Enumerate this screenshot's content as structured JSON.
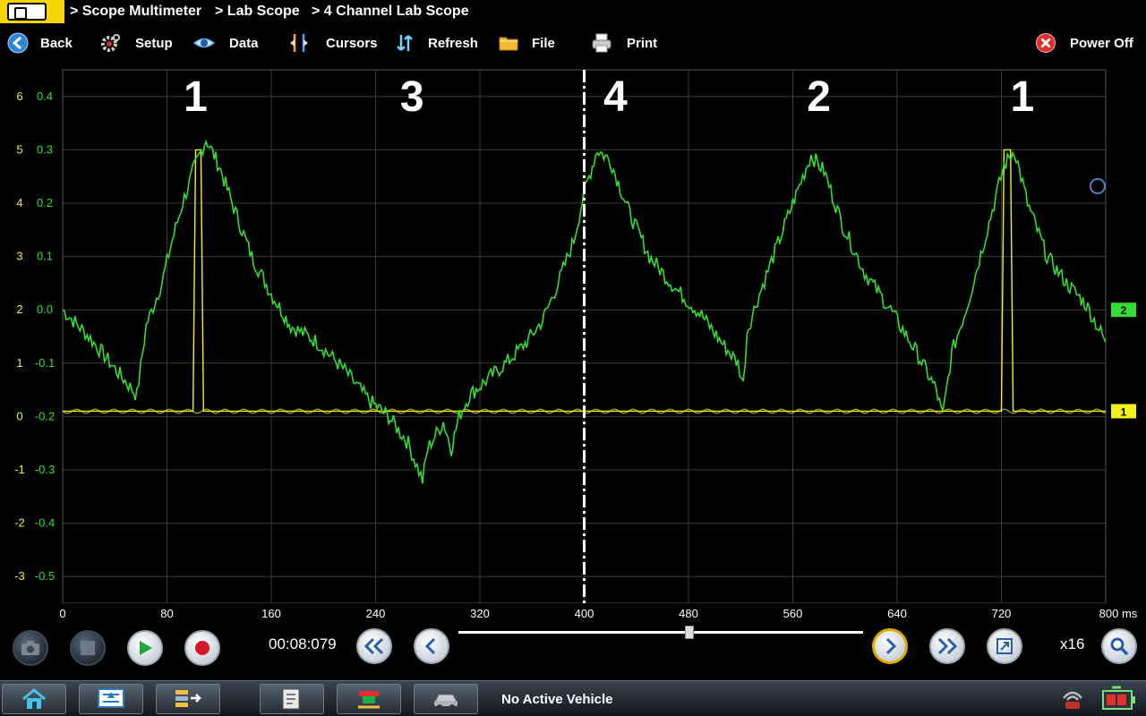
{
  "breadcrumb": {
    "items": [
      "> Scope Multimeter",
      "> Lab Scope",
      "> 4 Channel Lab Scope"
    ]
  },
  "toolbar": {
    "back_label": "Back",
    "setup_label": "Setup",
    "data_label": "Data",
    "cursors_label": "Cursors",
    "refresh_label": "Refresh",
    "file_label": "File",
    "print_label": "Print",
    "power_off_label": "Power Off"
  },
  "colors": {
    "channel1": "#f2f21b",
    "channel2": "#33dd33",
    "grid": "#3a3a3a",
    "accent_yellow": "#f5d400",
    "power_off_red": "#e03030"
  },
  "chart_data": {
    "type": "line",
    "x_unit": "ms",
    "x_ticks": [
      "0",
      "80",
      "160",
      "240",
      "320",
      "400",
      "480",
      "560",
      "640",
      "720",
      "800 ms"
    ],
    "xlim": [
      0,
      800
    ],
    "y_ticks_channel1": [
      "6",
      "5",
      "4",
      "3",
      "2",
      "1",
      "0",
      "-1",
      "-2",
      "-3"
    ],
    "y_ticks_channel2": [
      "0.4",
      "0.3",
      "0.2",
      "0.1",
      "0.0",
      "-0.1",
      "-0.2",
      "-0.3",
      "-0.4",
      "-0.5"
    ],
    "ylim_channel2": [
      -0.55,
      0.45
    ],
    "annotations": [
      {
        "text": "1",
        "x": 102
      },
      {
        "text": "3",
        "x": 268
      },
      {
        "text": "4",
        "x": 424
      },
      {
        "text": "2",
        "x": 580
      },
      {
        "text": "1",
        "x": 736
      }
    ],
    "cursor_x": 400,
    "series": [
      {
        "channel_marker": "1",
        "values": [
          [
            0,
            -0.19
          ],
          [
            100,
            -0.19
          ],
          [
            102,
            0.3
          ],
          [
            106,
            0.3
          ],
          [
            108,
            -0.19
          ],
          [
            720,
            -0.19
          ],
          [
            722,
            0.3
          ],
          [
            727,
            0.3
          ],
          [
            729,
            -0.19
          ],
          [
            800,
            -0.19
          ]
        ]
      },
      {
        "channel_marker": "2",
        "values": [
          [
            0,
            0.0
          ],
          [
            20,
            -0.05
          ],
          [
            40,
            -0.11
          ],
          [
            57,
            -0.16
          ],
          [
            64,
            -0.03
          ],
          [
            76,
            0.05
          ],
          [
            84,
            0.13
          ],
          [
            92,
            0.2
          ],
          [
            100,
            0.26
          ],
          [
            110,
            0.32
          ],
          [
            120,
            0.27
          ],
          [
            130,
            0.2
          ],
          [
            145,
            0.1
          ],
          [
            160,
            0.03
          ],
          [
            175,
            -0.03
          ],
          [
            195,
            -0.06
          ],
          [
            215,
            -0.11
          ],
          [
            235,
            -0.17
          ],
          [
            250,
            -0.2
          ],
          [
            265,
            -0.25
          ],
          [
            276,
            -0.32
          ],
          [
            280,
            -0.26
          ],
          [
            292,
            -0.21
          ],
          [
            298,
            -0.26
          ],
          [
            304,
            -0.2
          ],
          [
            312,
            -0.16
          ],
          [
            326,
            -0.13
          ],
          [
            340,
            -0.1
          ],
          [
            356,
            -0.06
          ],
          [
            368,
            -0.02
          ],
          [
            380,
            0.05
          ],
          [
            392,
            0.13
          ],
          [
            400,
            0.22
          ],
          [
            410,
            0.3
          ],
          [
            420,
            0.28
          ],
          [
            435,
            0.18
          ],
          [
            450,
            0.1
          ],
          [
            470,
            0.04
          ],
          [
            490,
            -0.01
          ],
          [
            505,
            -0.06
          ],
          [
            518,
            -0.1
          ],
          [
            522,
            -0.14
          ],
          [
            525,
            -0.04
          ],
          [
            533,
            0.02
          ],
          [
            545,
            0.1
          ],
          [
            560,
            0.2
          ],
          [
            574,
            0.29
          ],
          [
            584,
            0.26
          ],
          [
            598,
            0.16
          ],
          [
            615,
            0.07
          ],
          [
            635,
            0.0
          ],
          [
            655,
            -0.08
          ],
          [
            670,
            -0.15
          ],
          [
            675,
            -0.2
          ],
          [
            682,
            -0.08
          ],
          [
            694,
            0.01
          ],
          [
            708,
            0.14
          ],
          [
            722,
            0.27
          ],
          [
            730,
            0.3
          ],
          [
            740,
            0.2
          ],
          [
            755,
            0.1
          ],
          [
            770,
            0.05
          ],
          [
            785,
            0.01
          ],
          [
            800,
            -0.06
          ]
        ]
      }
    ]
  },
  "controls": {
    "timer": "00:08:079",
    "zoom_level": "x16",
    "slider_position": 0.57
  },
  "taskbar": {
    "vehicle_status": "No Active Vehicle"
  }
}
